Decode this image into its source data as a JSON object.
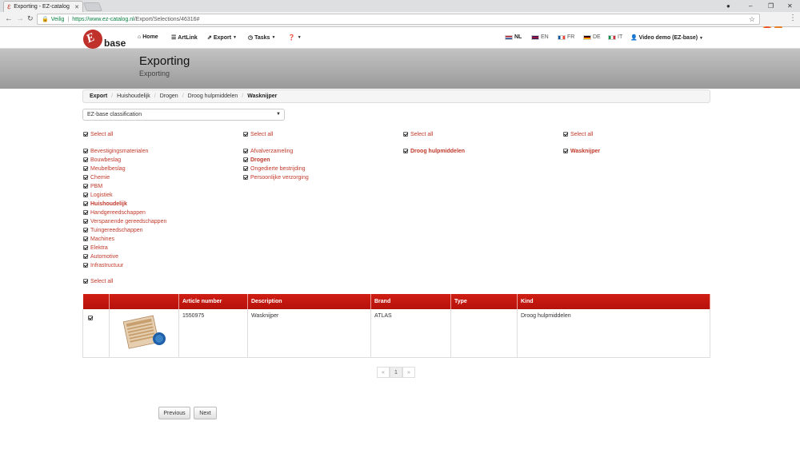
{
  "browser": {
    "tab_title": "Exporting - EZ-catalog",
    "secure_label": "Veilig",
    "url_host": "https://www.ez-catalog.nl",
    "url_path": "/Export/Selections/46316#"
  },
  "nav": {
    "home": "Home",
    "artlink": "ArtLink",
    "export": "Export",
    "tasks": "Tasks",
    "languages": [
      "NL",
      "EN",
      "FR",
      "DE",
      "IT"
    ],
    "user": "Video demo (EZ-base)"
  },
  "page": {
    "title": "Exporting",
    "subtitle": "Exporting"
  },
  "breadcrumb": [
    "Export",
    "Huishoudelijk",
    "Drogen",
    "Droog hulpmiddelen",
    "Wasknijper"
  ],
  "classification": "EZ-base classification",
  "select_all": "Select all",
  "col1": [
    "Bevestigingsmaterialen",
    "Bouwbeslag",
    "Meubelbeslag",
    "Chemie",
    "PBM",
    "Logistiek",
    "Huishoudelijk",
    "Handgereedschappen",
    "Verspanende gereedschappen",
    "Tuingereedschappen",
    "Machines",
    "Elektra",
    "Automotive",
    "Infrastructuur"
  ],
  "col2": [
    "Afvalverzameling",
    "Drogen",
    "Ongedierte bestrijding",
    "Persoonlijke verzorging"
  ],
  "col3": [
    "Droog hulpmiddelen"
  ],
  "col4": [
    "Wasknijper"
  ],
  "table": {
    "headers": [
      "",
      "",
      "Article number",
      "Description",
      "Brand",
      "Type",
      "Kind"
    ],
    "row": {
      "article_number": "1550975",
      "description": "Wasknijper",
      "brand": "ATLAS",
      "type": "",
      "kind": "Droog hulpmiddelen"
    }
  },
  "pager": {
    "prev": "«",
    "page": "1",
    "next": "»"
  },
  "buttons": {
    "previous": "Previous",
    "next": "Next"
  },
  "colors": {
    "accent": "#c0392b",
    "header_red": "#c4170f"
  }
}
